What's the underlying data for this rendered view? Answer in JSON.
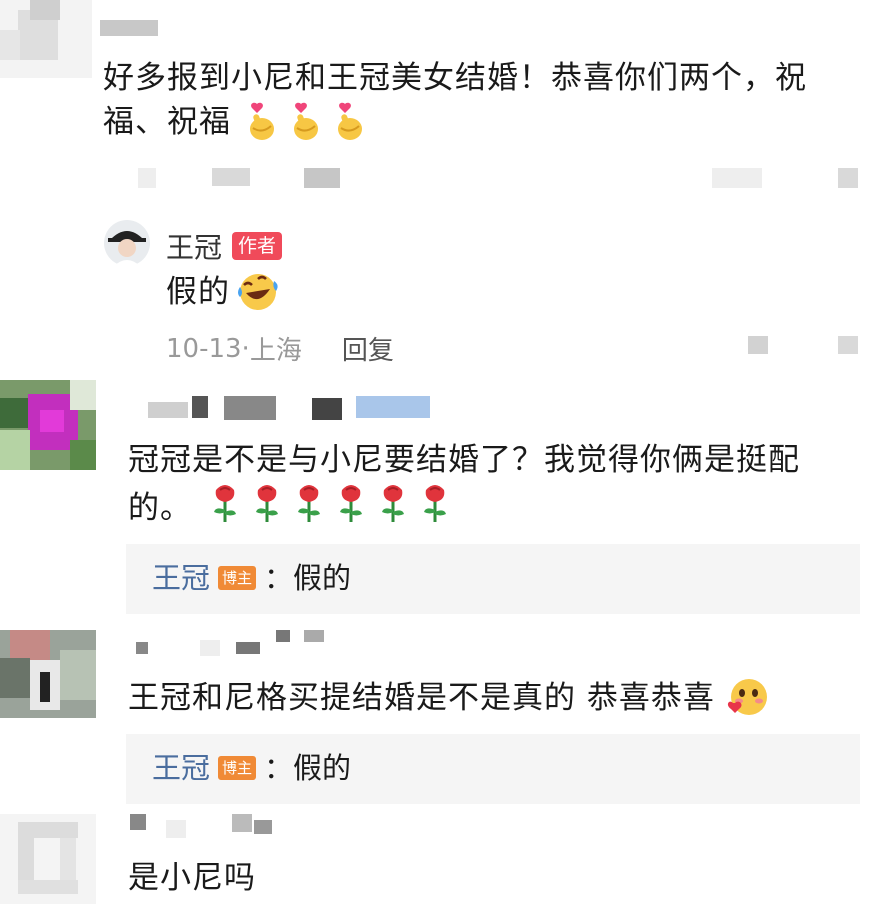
{
  "comments": [
    {
      "text_line1": "好多报到小尼和王冠美女结婚！恭喜你们两个，祝",
      "text_line2": "福、祝福",
      "emoji": "finger-heart-icon",
      "reply": {
        "author": "王冠",
        "badge": "作者",
        "text": "假的",
        "emoji": "laughing-tears-icon",
        "date": "10-13·",
        "location": "上海",
        "reply_label": "回复"
      }
    },
    {
      "text_line1": "冠冠是不是与小尼要结婚了？我觉得你俩是挺配",
      "text_line2": "的。",
      "emoji": "rose-icon",
      "reply": {
        "author": "王冠",
        "badge": "博主",
        "text": "：假的"
      }
    },
    {
      "text_line1": "王冠和尼格买提结婚是不是真的 恭喜恭喜",
      "emoji": "blushing-heart-icon",
      "reply": {
        "author": "王冠",
        "badge": "博主",
        "text": "：假的"
      }
    },
    {
      "text_line1": "是小尼吗"
    }
  ],
  "colors": {
    "author_badge": "#f04a5a",
    "blogger_badge": "#f08a36",
    "reply_name": "#4a6d9e",
    "reply_bg": "#f5f5f5"
  }
}
